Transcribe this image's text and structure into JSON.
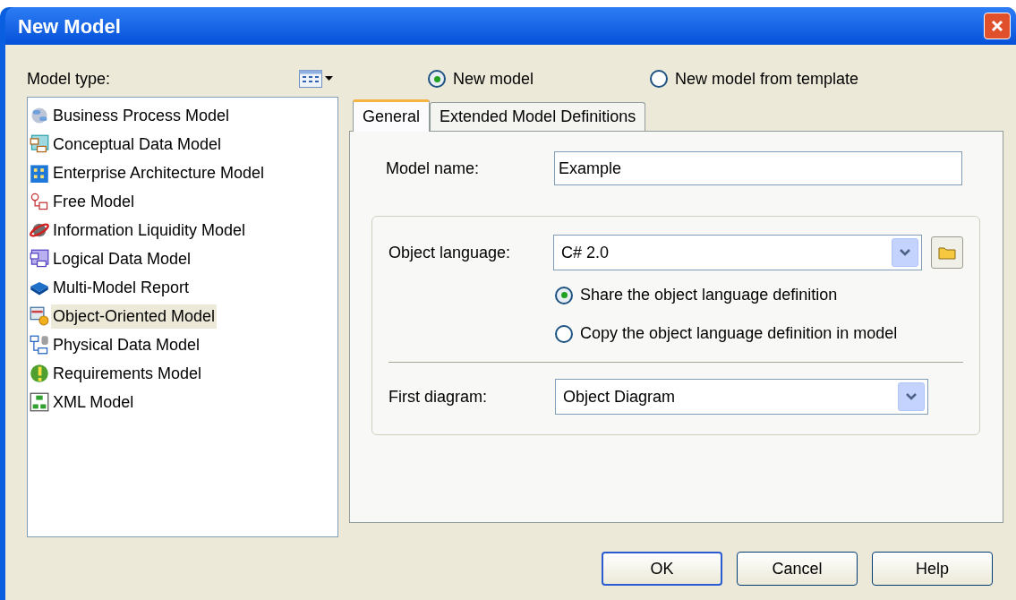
{
  "window": {
    "title": "New Model"
  },
  "model_type": {
    "label": "Model type:"
  },
  "model_types": [
    {
      "label": "Business Process Model",
      "selected": false
    },
    {
      "label": "Conceptual Data Model",
      "selected": false
    },
    {
      "label": "Enterprise Architecture Model",
      "selected": false
    },
    {
      "label": "Free Model",
      "selected": false
    },
    {
      "label": "Information Liquidity Model",
      "selected": false
    },
    {
      "label": "Logical Data Model",
      "selected": false
    },
    {
      "label": "Multi-Model Report",
      "selected": false
    },
    {
      "label": "Object-Oriented Model",
      "selected": true
    },
    {
      "label": "Physical Data Model",
      "selected": false
    },
    {
      "label": "Requirements Model",
      "selected": false
    },
    {
      "label": "XML Model",
      "selected": false
    }
  ],
  "mode": [
    {
      "label": "New model",
      "selected": true
    },
    {
      "label": "New model from template",
      "selected": false
    }
  ],
  "tabs": [
    {
      "label": "General",
      "selected": true
    },
    {
      "label": "Extended Model Definitions",
      "selected": false
    }
  ],
  "model_name": {
    "label": "Model name:",
    "value": "Example"
  },
  "object_language": {
    "label": "Object language:",
    "value": "C# 2.0"
  },
  "definition": [
    {
      "label": "Share the object language definition",
      "selected": true
    },
    {
      "label": "Copy the object language definition in model",
      "selected": false
    }
  ],
  "first_diagram": {
    "label": "First diagram:",
    "value": "Object Diagram"
  },
  "buttons": [
    "OK",
    "Cancel",
    "Help"
  ]
}
